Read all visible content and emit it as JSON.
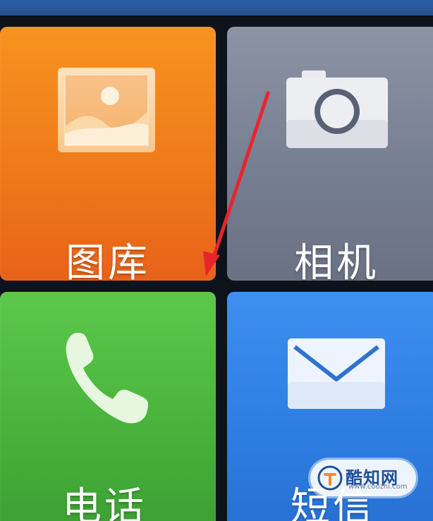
{
  "tiles": {
    "gallery": {
      "label": "图库",
      "icon": "image-icon",
      "color": "#f08020"
    },
    "camera": {
      "label": "相机",
      "icon": "camera-icon",
      "color": "#7b8396"
    },
    "phone": {
      "label": "电话",
      "icon": "phone-icon",
      "color": "#4cb43e"
    },
    "sms": {
      "label": "短信",
      "icon": "envelope-icon",
      "color": "#3182e6"
    }
  },
  "annotation": {
    "icon": "red-arrow-icon",
    "color": "#e8252b"
  },
  "watermark": {
    "name": "酷知网",
    "url": "www.coozhi.com"
  }
}
